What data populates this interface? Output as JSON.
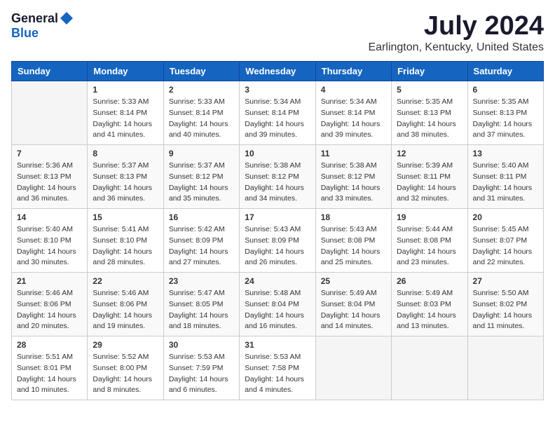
{
  "logo": {
    "general": "General",
    "blue": "Blue"
  },
  "title": "July 2024",
  "location": "Earlington, Kentucky, United States",
  "days_of_week": [
    "Sunday",
    "Monday",
    "Tuesday",
    "Wednesday",
    "Thursday",
    "Friday",
    "Saturday"
  ],
  "weeks": [
    [
      {
        "day": "",
        "sunrise": "",
        "sunset": "",
        "daylight": ""
      },
      {
        "day": "1",
        "sunrise": "Sunrise: 5:33 AM",
        "sunset": "Sunset: 8:14 PM",
        "daylight": "Daylight: 14 hours and 41 minutes."
      },
      {
        "day": "2",
        "sunrise": "Sunrise: 5:33 AM",
        "sunset": "Sunset: 8:14 PM",
        "daylight": "Daylight: 14 hours and 40 minutes."
      },
      {
        "day": "3",
        "sunrise": "Sunrise: 5:34 AM",
        "sunset": "Sunset: 8:14 PM",
        "daylight": "Daylight: 14 hours and 39 minutes."
      },
      {
        "day": "4",
        "sunrise": "Sunrise: 5:34 AM",
        "sunset": "Sunset: 8:14 PM",
        "daylight": "Daylight: 14 hours and 39 minutes."
      },
      {
        "day": "5",
        "sunrise": "Sunrise: 5:35 AM",
        "sunset": "Sunset: 8:13 PM",
        "daylight": "Daylight: 14 hours and 38 minutes."
      },
      {
        "day": "6",
        "sunrise": "Sunrise: 5:35 AM",
        "sunset": "Sunset: 8:13 PM",
        "daylight": "Daylight: 14 hours and 37 minutes."
      }
    ],
    [
      {
        "day": "7",
        "sunrise": "Sunrise: 5:36 AM",
        "sunset": "Sunset: 8:13 PM",
        "daylight": "Daylight: 14 hours and 36 minutes."
      },
      {
        "day": "8",
        "sunrise": "Sunrise: 5:37 AM",
        "sunset": "Sunset: 8:13 PM",
        "daylight": "Daylight: 14 hours and 36 minutes."
      },
      {
        "day": "9",
        "sunrise": "Sunrise: 5:37 AM",
        "sunset": "Sunset: 8:12 PM",
        "daylight": "Daylight: 14 hours and 35 minutes."
      },
      {
        "day": "10",
        "sunrise": "Sunrise: 5:38 AM",
        "sunset": "Sunset: 8:12 PM",
        "daylight": "Daylight: 14 hours and 34 minutes."
      },
      {
        "day": "11",
        "sunrise": "Sunrise: 5:38 AM",
        "sunset": "Sunset: 8:12 PM",
        "daylight": "Daylight: 14 hours and 33 minutes."
      },
      {
        "day": "12",
        "sunrise": "Sunrise: 5:39 AM",
        "sunset": "Sunset: 8:11 PM",
        "daylight": "Daylight: 14 hours and 32 minutes."
      },
      {
        "day": "13",
        "sunrise": "Sunrise: 5:40 AM",
        "sunset": "Sunset: 8:11 PM",
        "daylight": "Daylight: 14 hours and 31 minutes."
      }
    ],
    [
      {
        "day": "14",
        "sunrise": "Sunrise: 5:40 AM",
        "sunset": "Sunset: 8:10 PM",
        "daylight": "Daylight: 14 hours and 30 minutes."
      },
      {
        "day": "15",
        "sunrise": "Sunrise: 5:41 AM",
        "sunset": "Sunset: 8:10 PM",
        "daylight": "Daylight: 14 hours and 28 minutes."
      },
      {
        "day": "16",
        "sunrise": "Sunrise: 5:42 AM",
        "sunset": "Sunset: 8:09 PM",
        "daylight": "Daylight: 14 hours and 27 minutes."
      },
      {
        "day": "17",
        "sunrise": "Sunrise: 5:43 AM",
        "sunset": "Sunset: 8:09 PM",
        "daylight": "Daylight: 14 hours and 26 minutes."
      },
      {
        "day": "18",
        "sunrise": "Sunrise: 5:43 AM",
        "sunset": "Sunset: 8:08 PM",
        "daylight": "Daylight: 14 hours and 25 minutes."
      },
      {
        "day": "19",
        "sunrise": "Sunrise: 5:44 AM",
        "sunset": "Sunset: 8:08 PM",
        "daylight": "Daylight: 14 hours and 23 minutes."
      },
      {
        "day": "20",
        "sunrise": "Sunrise: 5:45 AM",
        "sunset": "Sunset: 8:07 PM",
        "daylight": "Daylight: 14 hours and 22 minutes."
      }
    ],
    [
      {
        "day": "21",
        "sunrise": "Sunrise: 5:46 AM",
        "sunset": "Sunset: 8:06 PM",
        "daylight": "Daylight: 14 hours and 20 minutes."
      },
      {
        "day": "22",
        "sunrise": "Sunrise: 5:46 AM",
        "sunset": "Sunset: 8:06 PM",
        "daylight": "Daylight: 14 hours and 19 minutes."
      },
      {
        "day": "23",
        "sunrise": "Sunrise: 5:47 AM",
        "sunset": "Sunset: 8:05 PM",
        "daylight": "Daylight: 14 hours and 18 minutes."
      },
      {
        "day": "24",
        "sunrise": "Sunrise: 5:48 AM",
        "sunset": "Sunset: 8:04 PM",
        "daylight": "Daylight: 14 hours and 16 minutes."
      },
      {
        "day": "25",
        "sunrise": "Sunrise: 5:49 AM",
        "sunset": "Sunset: 8:04 PM",
        "daylight": "Daylight: 14 hours and 14 minutes."
      },
      {
        "day": "26",
        "sunrise": "Sunrise: 5:49 AM",
        "sunset": "Sunset: 8:03 PM",
        "daylight": "Daylight: 14 hours and 13 minutes."
      },
      {
        "day": "27",
        "sunrise": "Sunrise: 5:50 AM",
        "sunset": "Sunset: 8:02 PM",
        "daylight": "Daylight: 14 hours and 11 minutes."
      }
    ],
    [
      {
        "day": "28",
        "sunrise": "Sunrise: 5:51 AM",
        "sunset": "Sunset: 8:01 PM",
        "daylight": "Daylight: 14 hours and 10 minutes."
      },
      {
        "day": "29",
        "sunrise": "Sunrise: 5:52 AM",
        "sunset": "Sunset: 8:00 PM",
        "daylight": "Daylight: 14 hours and 8 minutes."
      },
      {
        "day": "30",
        "sunrise": "Sunrise: 5:53 AM",
        "sunset": "Sunset: 7:59 PM",
        "daylight": "Daylight: 14 hours and 6 minutes."
      },
      {
        "day": "31",
        "sunrise": "Sunrise: 5:53 AM",
        "sunset": "Sunset: 7:58 PM",
        "daylight": "Daylight: 14 hours and 4 minutes."
      },
      {
        "day": "",
        "sunrise": "",
        "sunset": "",
        "daylight": ""
      },
      {
        "day": "",
        "sunrise": "",
        "sunset": "",
        "daylight": ""
      },
      {
        "day": "",
        "sunrise": "",
        "sunset": "",
        "daylight": ""
      }
    ]
  ]
}
